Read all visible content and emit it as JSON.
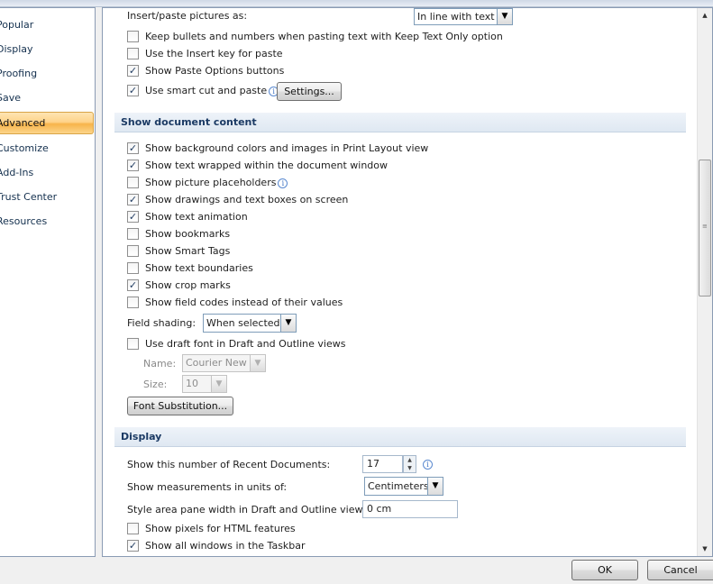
{
  "nav": {
    "items": [
      {
        "label": "Popular"
      },
      {
        "label": "Display"
      },
      {
        "label": "Proofing"
      },
      {
        "label": "Save"
      },
      {
        "label": "Advanced",
        "active": true
      },
      {
        "label": "Customize"
      },
      {
        "label": "Add-Ins"
      },
      {
        "label": "Trust Center"
      },
      {
        "label": "Resources"
      }
    ]
  },
  "cut_copy_paste": {
    "insert_paste_label": "Insert/paste pictures as:",
    "insert_paste_value": "In line with text",
    "options": [
      {
        "label": "Keep bullets and numbers when pasting text with Keep Text Only option",
        "checked": false
      },
      {
        "label": "Use the Insert key for paste",
        "checked": false
      },
      {
        "label": "Show Paste Options buttons",
        "checked": true
      },
      {
        "label": "Use smart cut and paste",
        "checked": true
      }
    ],
    "settings_button": "Settings..."
  },
  "show_document_content": {
    "title": "Show document content",
    "options": [
      {
        "label": "Show background colors and images in Print Layout view",
        "checked": true
      },
      {
        "label": "Show text wrapped within the document window",
        "checked": true
      },
      {
        "label": "Show picture placeholders",
        "checked": false
      },
      {
        "label": "Show drawings and text boxes on screen",
        "checked": true
      },
      {
        "label": "Show text animation",
        "checked": true
      },
      {
        "label": "Show bookmarks",
        "checked": false
      },
      {
        "label": "Show Smart Tags",
        "checked": false
      },
      {
        "label": "Show text boundaries",
        "checked": false
      },
      {
        "label": "Show crop marks",
        "checked": true
      },
      {
        "label": "Show field codes instead of their values",
        "checked": false
      }
    ],
    "field_shading_label": "Field shading:",
    "field_shading_value": "When selected",
    "draft_font_label": "Use draft font in Draft and Outline views",
    "draft_font_checked": false,
    "name_label": "Name:",
    "name_value": "Courier New",
    "size_label": "Size:",
    "size_value": "10",
    "font_substitution_button": "Font Substitution..."
  },
  "display": {
    "title": "Display",
    "recent_docs_label": "Show this number of Recent Documents:",
    "recent_docs_value": "17",
    "measurement_label": "Show measurements in units of:",
    "measurement_value": "Centimeters",
    "style_area_label": "Style area pane width in Draft and Outline views:",
    "style_area_value": "0 cm",
    "options": [
      {
        "label": "Show pixels for HTML features",
        "checked": false
      },
      {
        "label": "Show all windows in the Taskbar",
        "checked": true
      }
    ]
  },
  "footer": {
    "ok_label": "OK",
    "cancel_label": "Cancel"
  },
  "icons": {
    "check_glyph": "✓",
    "info_glyph": "i",
    "dropdown_glyph": "▼",
    "scroll_up": "▲",
    "scroll_down": "▼",
    "grip": "≡"
  }
}
